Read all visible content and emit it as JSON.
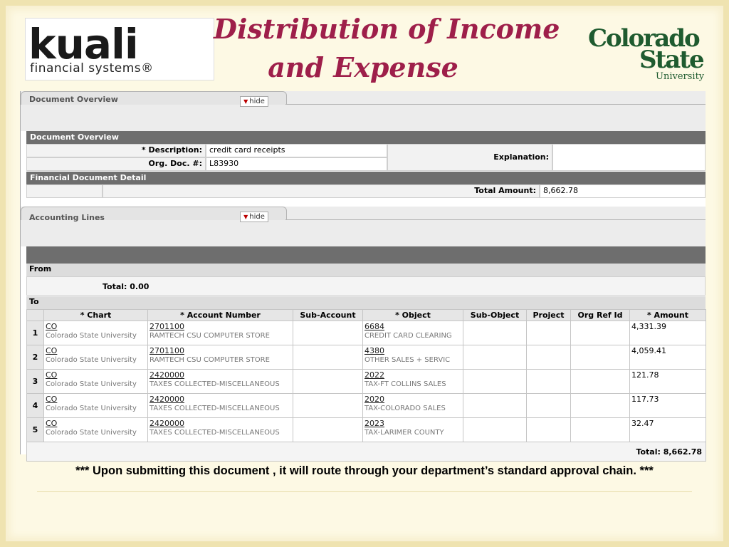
{
  "slide": {
    "title_line1": "Distribution of Income",
    "title_line2": "and Expense",
    "kuali_logo": {
      "brand": "kuali",
      "tagline": "financial systems®"
    },
    "csu_logo": {
      "line1": "Colorado",
      "line2": "State",
      "line3": "University"
    },
    "footer_note": "*** Upon submitting this document , it will route through your department’s standard approval chain. ***"
  },
  "document_overview_tab": {
    "label": "Document Overview",
    "hide_label": "hide"
  },
  "document_overview": {
    "header": "Document Overview",
    "description_label": "* Description:",
    "description_value": "credit card receipts",
    "org_doc_label": "Org. Doc. #:",
    "org_doc_value": "L83930",
    "explanation_label": "Explanation:",
    "explanation_value": ""
  },
  "financial_detail": {
    "header": "Financial Document Detail",
    "total_amount_label": "Total Amount:",
    "total_amount_value": "8,662.78"
  },
  "accounting_lines_tab": {
    "label": "Accounting Lines",
    "hide_label": "hide"
  },
  "accounting": {
    "from_label": "From",
    "from_total": "Total: 0.00",
    "to_label": "To",
    "columns": [
      "* Chart",
      "* Account Number",
      "Sub-Account",
      "* Object",
      "Sub-Object",
      "Project",
      "Org Ref Id",
      "* Amount"
    ],
    "rows": [
      {
        "num": "1",
        "chart": "CO",
        "chart_name": "Colorado State University",
        "account": "2701100",
        "account_name": "RAMTECH CSU COMPUTER STORE",
        "object": "6684",
        "object_name": "CREDIT CARD CLEARING",
        "amount": "4,331.39"
      },
      {
        "num": "2",
        "chart": "CO",
        "chart_name": "Colorado State University",
        "account": "2701100",
        "account_name": "RAMTECH CSU COMPUTER STORE",
        "object": "4380",
        "object_name": "OTHER SALES + SERVIC",
        "amount": "4,059.41"
      },
      {
        "num": "3",
        "chart": "CO",
        "chart_name": "Colorado State University",
        "account": "2420000",
        "account_name": "TAXES COLLECTED-MISCELLANEOUS",
        "object": "2022",
        "object_name": "TAX-FT COLLINS SALES",
        "amount": "121.78"
      },
      {
        "num": "4",
        "chart": "CO",
        "chart_name": "Colorado State University",
        "account": "2420000",
        "account_name": "TAXES COLLECTED-MISCELLANEOUS",
        "object": "2020",
        "object_name": "TAX-COLORADO SALES",
        "amount": "117.73"
      },
      {
        "num": "5",
        "chart": "CO",
        "chart_name": "Colorado State University",
        "account": "2420000",
        "account_name": "TAXES COLLECTED-MISCELLANEOUS",
        "object": "2023",
        "object_name": "TAX-LARIMER COUNTY",
        "amount": "32.47"
      }
    ],
    "to_total": "Total: 8,662.78"
  }
}
